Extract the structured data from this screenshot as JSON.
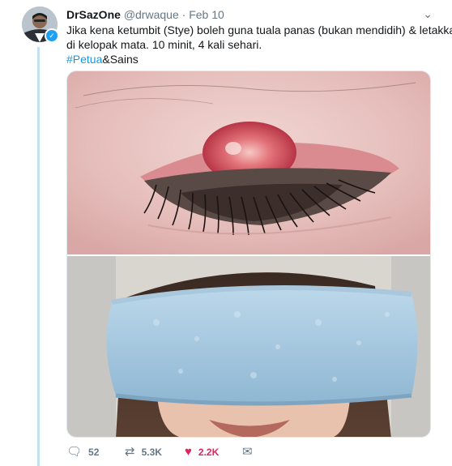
{
  "tweet": {
    "author_name": "DrSazOne",
    "handle": "@drwaque",
    "separator": "·",
    "date": "Feb 10",
    "text_line1": "Jika kena ketumbit (Stye) boleh guna tuala panas (bukan mendidih) & letakkan",
    "text_line2": "di kelopak mata. 10 minit, 4 kali sehari.",
    "hashtag": "#Petua",
    "text_after_hashtag": "&Sains"
  },
  "actions": {
    "replies": "52",
    "retweets": "5.3K",
    "likes": "2.2K"
  },
  "icons": {
    "caret": "chevron-down-icon",
    "reply": "speech-bubble-icon",
    "retweet": "retweet-arrows-icon",
    "like": "heart-icon",
    "dm": "envelope-icon",
    "verified": "verified-badge-icon"
  },
  "colors": {
    "link": "#1b95e0",
    "like": "#e0245e",
    "muted": "#657786",
    "thread_line": "#c4e0f4"
  }
}
